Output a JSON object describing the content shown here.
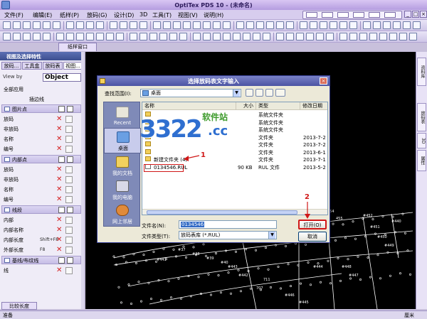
{
  "window": {
    "title": "OptiTex PDS 10 - (未命名)",
    "controls": [
      "_",
      "□",
      "×"
    ]
  },
  "menu": [
    "文件(F)",
    "编辑(E)",
    "纸样(P)",
    "放码(G)",
    "设计(D)",
    "3D",
    "工具(T)",
    "视图(V)",
    "说明(H)"
  ],
  "pattern_window_tab": "纸样窗口",
  "left_panel": {
    "title": "视图及选择特性",
    "tabs": [
      "放码...",
      "工具盒",
      "放码表",
      "视图..."
    ],
    "view_by_label": "View by",
    "view_by_value": "Object",
    "rows": [
      {
        "label": "全部应用",
        "type": "plain"
      },
      {
        "label": "插边线",
        "type": "subhead"
      },
      {
        "label": "图片点",
        "type": "head"
      },
      {
        "label": "放码",
        "type": "x"
      },
      {
        "label": "非放码",
        "type": "x"
      },
      {
        "label": "名称",
        "type": "x"
      },
      {
        "label": "编号",
        "type": "x"
      },
      {
        "label": "内部点",
        "type": "head"
      },
      {
        "label": "放码",
        "type": "x"
      },
      {
        "label": "非放码",
        "type": "x"
      },
      {
        "label": "名称",
        "type": "x"
      },
      {
        "label": "编号",
        "type": "x"
      },
      {
        "label": "线段",
        "type": "head"
      },
      {
        "label": "内部",
        "type": "x"
      },
      {
        "label": "内部名称",
        "type": "x"
      },
      {
        "label": "内部长度",
        "type": "x",
        "shortcut": "Shift+F8"
      },
      {
        "label": "外部长度",
        "type": "x",
        "shortcut": "F8"
      },
      {
        "label": "基线/布纹线",
        "type": "head"
      },
      {
        "label": "线",
        "type": "x"
      }
    ],
    "bottom_tab": "比较长度"
  },
  "right_dock_tabs": [
    "资料库",
    "放码表",
    "3D",
    "属性"
  ],
  "status": {
    "left": "准备",
    "unit": "厘米"
  },
  "dialog": {
    "title": "选择放码表文字输入",
    "look_in_label": "查找范围(I):",
    "look_in_value": "桌面",
    "places": [
      "Recent",
      "桌面",
      "我的文档",
      "我的电脑",
      "网上邻居"
    ],
    "columns": [
      "名称",
      "大小",
      "类型",
      "修改日期"
    ],
    "files": [
      {
        "name": "",
        "size": "",
        "type": "系统文件夹",
        "date": ""
      },
      {
        "name": "",
        "size": "",
        "type": "系统文件夹",
        "date": ""
      },
      {
        "name": "",
        "size": "",
        "type": "系统文件夹",
        "date": ""
      },
      {
        "name": "",
        "size": "",
        "type": "文件夹",
        "date": "2013-7-2"
      },
      {
        "name": "",
        "size": "",
        "type": "文件夹",
        "date": "2013-7-2"
      },
      {
        "name": "",
        "size": "",
        "type": "文件夹",
        "date": "2013-6-1"
      },
      {
        "name": "新建文件夹 (4)",
        "size": "",
        "type": "文件夹",
        "date": "2013-7-1"
      },
      {
        "name": "0134546.RUL",
        "size": "90 KB",
        "type": "RUL 文件",
        "date": "2013-5-2"
      }
    ],
    "file_name_label": "文件名(N):",
    "file_name_value": "0134546",
    "file_type_label": "文件类型(T):",
    "file_type_value": "放码表库 (*.RUL)",
    "open_button": "打开(O)",
    "cancel_button": "取消"
  },
  "annotations": [
    "1",
    "2"
  ],
  "watermark": {
    "number": "3322",
    "site": "软件站",
    "suffix": ".cc"
  },
  "canvas_labels": [
    "454",
    "455",
    "439",
    "711",
    "707",
    "#37",
    "#38",
    "#39",
    "#40",
    "#452",
    "#451",
    "#450",
    "#449",
    "#448",
    "#447",
    "#446",
    "#445",
    "#444",
    "#443",
    "#442",
    "#441",
    "#440"
  ]
}
